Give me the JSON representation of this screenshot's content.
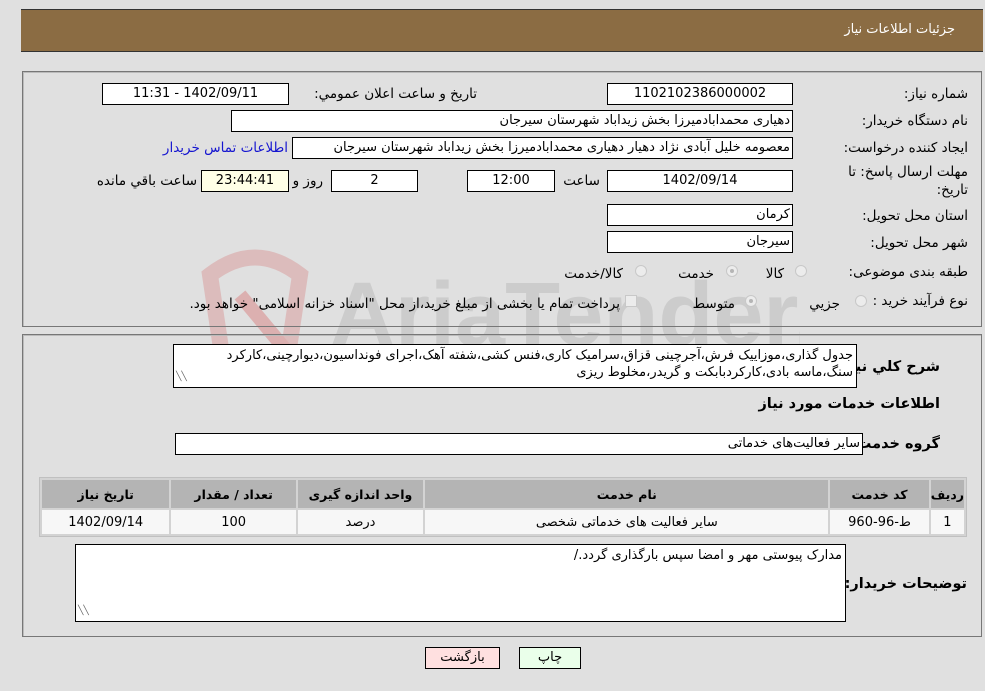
{
  "header": {
    "title": "جزئیات اطلاعات نیاز"
  },
  "fields": {
    "need_number": {
      "label": "شماره نیاز:",
      "value": "1102102386000002"
    },
    "announce_datetime": {
      "label": "تاریخ و ساعت اعلان عمومي:",
      "value": "1402/09/11 - 11:31"
    },
    "buyer_org": {
      "label": "نام دستگاه خریدار:",
      "value": "دهیاری محمدابادمیرزا بخش زیداباد شهرستان سیرجان"
    },
    "requester": {
      "label": "ایجاد کننده درخواست:",
      "value": "معصومه خلیل آبادی نژاد دهیار دهیاری محمدابادمیرزا بخش زیداباد شهرستان سیرجان"
    },
    "contact_link": "اطلاعات تماس خریدار",
    "deadline": {
      "label": "مهلت ارسال پاسخ: تا تاریخ:",
      "date": "1402/09/14",
      "time_label": "ساعت",
      "time": "12:00",
      "days": "2",
      "days_label": "روز و",
      "remaining": "23:44:41",
      "remaining_label": "ساعت باقي مانده"
    },
    "province": {
      "label": "استان محل تحویل:",
      "value": "کرمان"
    },
    "city": {
      "label": "شهر محل تحویل:",
      "value": "سیرجان"
    },
    "category": {
      "label": "طبقه بندی موضوعی:",
      "options": [
        "کالا",
        "خدمت",
        "کالا/خدمت"
      ],
      "selected": "خدمت"
    },
    "purchase_type": {
      "label": "نوع فرآیند خرید :",
      "options": [
        "جزیي",
        "متوسط"
      ],
      "selected": "متوسط",
      "treasury_checkbox_label": "پرداخت تمام یا بخشی از مبلغ خرید،از محل \"اسناد خزانه اسلامی\" خواهد بود.",
      "treasury_checked": false
    }
  },
  "description": {
    "label": "شرح کلي نیاز:",
    "value": "جدول گذاری،موزاییک فرش،آجرچینی قزاق،سرامیک کاری،فنس کشی،شفته آهک،اجرای فونداسیون،دیوارچینی،کارکرد سنگ،ماسه بادی،کارکردبابکت و گریدر،مخلوط ریزی"
  },
  "services_section": {
    "title": "اطلاعات خدمات مورد نیاز",
    "group_label": "گروه خدمت:",
    "group_value": "سایر فعالیت‌های خدماتی"
  },
  "table": {
    "columns": [
      "ردیف",
      "کد خدمت",
      "نام خدمت",
      "واحد اندازه گیری",
      "تعداد / مقدار",
      "تاریخ نیاز"
    ],
    "rows": [
      [
        "1",
        "ط-96-960",
        "سایر فعالیت های خدماتی شخصی",
        "درصد",
        "100",
        "1402/09/14"
      ]
    ]
  },
  "buyer_notes": {
    "label": "توضیحات خریدار:",
    "value": "مدارک پیوستی مهر و امضا سپس بارگذاری گردد./"
  },
  "buttons": {
    "print": "چاپ",
    "back": "بازگشت"
  },
  "colors": {
    "header_bg": "#8b6c43",
    "link": "#1515d0",
    "print_bg": "#eaffea",
    "back_bg": "#ffe0e0"
  }
}
